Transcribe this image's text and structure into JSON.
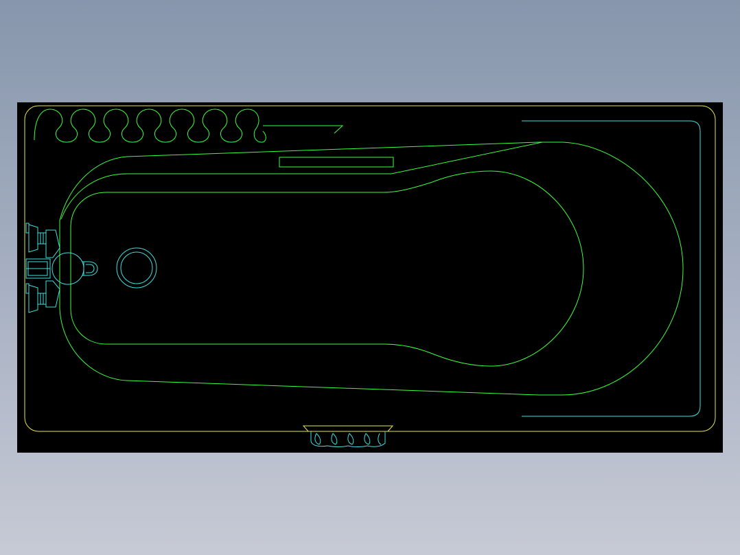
{
  "drawing": {
    "subject": "bathtub-plan-view",
    "background_color": "#000000",
    "page_gradient": [
      "#8796ac",
      "#c7cad5"
    ],
    "colors": {
      "outline": "#e8e84a",
      "basin": "#3cff3c",
      "fittings": "#3fe0e0"
    },
    "icons": [
      "wave-border-icon",
      "faucet-icon",
      "drain-icon",
      "handle-grip-icon",
      "overflow-slot-icon"
    ]
  }
}
